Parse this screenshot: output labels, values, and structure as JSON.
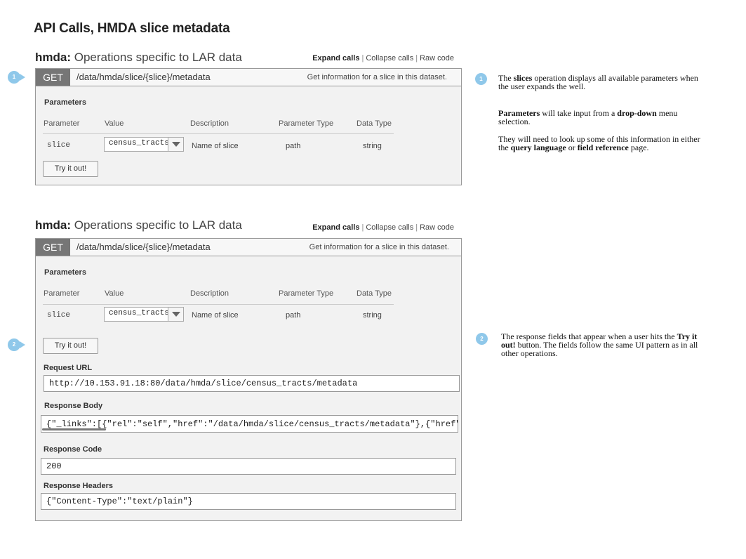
{
  "page_title": "API Calls, HMDA slice metadata",
  "section": {
    "title_bold": "hmda:",
    "title_rest": " Operations specific to LAR data",
    "expand_label": "Expand calls",
    "collapse_label": "Collapse calls",
    "raw_label": "Raw code",
    "separator": "|"
  },
  "operation": {
    "verb": "GET",
    "path": "/data/hmda/slice/{slice}/metadata",
    "description": "Get information for a slice in this dataset."
  },
  "parameters": {
    "heading": "Parameters",
    "columns": [
      "Parameter",
      "Value",
      "Description",
      "Parameter Type",
      "Data Type"
    ],
    "row": {
      "name": "slice",
      "value": "census_tracts",
      "description": "Name of slice",
      "param_type": "path",
      "data_type": "string"
    }
  },
  "try_button": "Try it out!",
  "response": {
    "request_url_label": "Request URL",
    "request_url": "http://10.153.91.18:80/data/hmda/slice/census_tracts/metadata",
    "body_label": "Response Body",
    "body": "{\"_links\":[{\"rel\":\"self\",\"href\":\"/data/hmda/slice/census_tracts/metadata\"},{\"href\":\"",
    "code_label": "Response Code",
    "code": "200",
    "headers_label": "Response Headers",
    "headers": "{\"Content-Type\":\"text/plain\"}"
  },
  "markers": [
    "1",
    "2"
  ],
  "notes": {
    "n1": {
      "p1_a": "The ",
      "p1_b": "slices",
      "p1_c": " operation displays all available parameters when",
      "p1_d": "the user expands the well.",
      "p2_a": "Parameters",
      "p2_b": " will take input from a ",
      "p2_c": "drop-down",
      "p2_d": " menu",
      "p2_e": "selection.",
      "p3_a": "They will need to look up some of this information in either",
      "p3_b": "the ",
      "p3_c": "query language",
      "p3_d": " or ",
      "p3_e": "field reference",
      "p3_f": " page."
    },
    "n2": {
      "l1_a": "The response fields that appear when a user hits the ",
      "l1_b": "Try it",
      "l2_a": "out!",
      "l2_b": " button. The fields follow the same UI pattern as in all",
      "l3": "other operations."
    }
  },
  "colors": {
    "verb_bg": "#767676",
    "panel_bg": "#f2f2f2",
    "marker": "#8fc8ea"
  },
  "icons": [
    "chevron-down-icon"
  ]
}
